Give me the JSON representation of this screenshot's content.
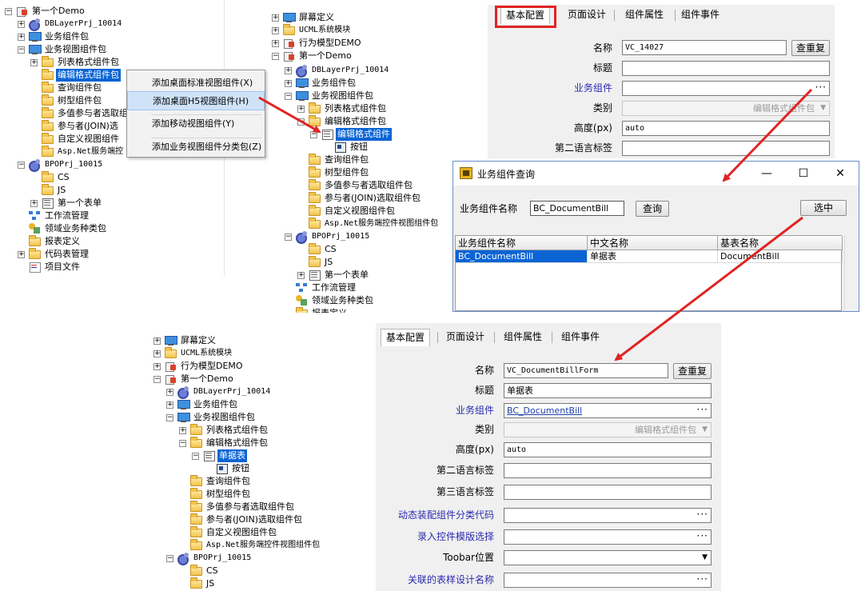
{
  "panel1": {
    "tree": [
      {
        "label": "第一个Demo",
        "icon": "proj-icon",
        "exp": "−"
      },
      {
        "label": "DBLayerPrj_10014",
        "icon": "gear-icon",
        "exp": "+",
        "mono": true
      },
      {
        "label": "业务组件包",
        "icon": "monitor-icon",
        "exp": "+"
      },
      {
        "label": "业务视图组件包",
        "icon": "monitor-icon",
        "exp": "−"
      },
      {
        "label": "列表格式组件包",
        "icon": "folder-icon",
        "exp": "+"
      },
      {
        "label": "编辑格式组件包",
        "icon": "folder-icon",
        "exp": "",
        "selected": true
      },
      {
        "label": "查询组件包",
        "icon": "folder-icon",
        "exp": ""
      },
      {
        "label": "树型组件包",
        "icon": "folder-icon",
        "exp": ""
      },
      {
        "label": "多值参与者选取组",
        "icon": "folder-icon",
        "exp": ""
      },
      {
        "label": "参与者(JOIN)选",
        "icon": "folder-icon",
        "exp": ""
      },
      {
        "label": "自定义视图组件",
        "icon": "folder-icon",
        "exp": ""
      },
      {
        "label": "Asp.Net服务端控",
        "icon": "folder-icon",
        "exp": "",
        "mono": true
      },
      {
        "label": "BPOPrj_10015",
        "icon": "gear-icon",
        "exp": "−",
        "mono": true
      },
      {
        "label": "CS",
        "icon": "folder-icon",
        "exp": ""
      },
      {
        "label": "JS",
        "icon": "folder-icon",
        "exp": ""
      },
      {
        "label": "第一个表单",
        "icon": "form-icon",
        "exp": "+"
      },
      {
        "label": "工作流管理",
        "icon": "flow-icon",
        "exp": ""
      },
      {
        "label": "领域业务种类包",
        "icon": "domain-icon",
        "exp": ""
      },
      {
        "label": "报表定义",
        "icon": "folder-icon",
        "exp": ""
      },
      {
        "label": "代码表管理",
        "icon": "folder-icon",
        "exp": "+"
      },
      {
        "label": "项目文件",
        "icon": "code-icon",
        "exp": ""
      }
    ],
    "context_menu": [
      "添加桌面标准视图组件(X)",
      "添加桌面H5视图组件(H)",
      "添加移动视图组件(Y)",
      "添加业务视图组件分类包(Z)"
    ]
  },
  "panel2": {
    "tree": [
      {
        "label": "屏幕定义",
        "icon": "monitor-icon",
        "exp": "+"
      },
      {
        "label": "UCML系统模块",
        "icon": "folder-icon",
        "exp": "+",
        "mono": true
      },
      {
        "label": "行为模型DEMO",
        "icon": "proj-icon",
        "exp": "+"
      },
      {
        "label": "第一个Demo",
        "icon": "proj-icon",
        "exp": "−"
      },
      {
        "label": "DBLayerPrj_10014",
        "icon": "gear-icon",
        "exp": "+",
        "mono": true
      },
      {
        "label": "业务组件包",
        "icon": "monitor-icon",
        "exp": "+"
      },
      {
        "label": "业务视图组件包",
        "icon": "monitor-icon",
        "exp": "−"
      },
      {
        "label": "列表格式组件包",
        "icon": "folder-icon",
        "exp": "+"
      },
      {
        "label": "编辑格式组件包",
        "icon": "folder-icon",
        "exp": "−"
      },
      {
        "label": "编辑格式组件",
        "icon": "form-icon",
        "exp": "−",
        "selected": true
      },
      {
        "label": "按钮",
        "icon": "button-icon",
        "exp": ""
      },
      {
        "label": "查询组件包",
        "icon": "folder-icon",
        "exp": ""
      },
      {
        "label": "树型组件包",
        "icon": "folder-icon",
        "exp": ""
      },
      {
        "label": "多值参与者选取组件包",
        "icon": "folder-icon",
        "exp": ""
      },
      {
        "label": "参与者(JOIN)选取组件包",
        "icon": "folder-icon",
        "exp": ""
      },
      {
        "label": "自定义视图组件包",
        "icon": "folder-icon",
        "exp": ""
      },
      {
        "label": "Asp.Net服务端控件视图组件包",
        "icon": "folder-icon",
        "exp": "",
        "mono": true
      },
      {
        "label": "BPOPrj_10015",
        "icon": "gear-icon",
        "exp": "−",
        "mono": true
      },
      {
        "label": "CS",
        "icon": "folder-icon",
        "exp": ""
      },
      {
        "label": "JS",
        "icon": "folder-icon",
        "exp": ""
      },
      {
        "label": "第一个表单",
        "icon": "form-icon",
        "exp": "+"
      },
      {
        "label": "工作流管理",
        "icon": "flow-icon",
        "exp": ""
      },
      {
        "label": "领域业务种类包",
        "icon": "domain-icon",
        "exp": ""
      },
      {
        "label": "报表定义",
        "icon": "folder-icon",
        "exp": ""
      }
    ]
  },
  "form1": {
    "tabs": [
      "基本配置",
      "页面设计",
      "组件属性",
      "组件事件"
    ],
    "fields": {
      "name_label": "名称",
      "name_value": "VC_14027",
      "reset_button": "查重复",
      "title_label": "标题",
      "title_value": "",
      "bc_label": "业务组件",
      "bc_value": "",
      "category_label": "类别",
      "category_value": "编辑格式组件包",
      "height_label": "高度(px)",
      "height_value": "auto",
      "lang2_label": "第二语言标签",
      "lang2_value": ""
    }
  },
  "dialog": {
    "title": "业务组件查询",
    "search_label": "业务组件名称",
    "search_value": "BC_DocumentBill",
    "query_button": "查询",
    "select_button": "选中",
    "columns": [
      "业务组件名称",
      "中文名称",
      "基表名称"
    ],
    "rows": [
      [
        "BC_DocumentBill",
        "单据表",
        "DocumentBill"
      ]
    ],
    "controls": {
      "minimize": "—",
      "maximize": "☐",
      "close": "✕"
    }
  },
  "panel3": {
    "tree": [
      {
        "label": "屏幕定义",
        "icon": "monitor-icon",
        "exp": "+"
      },
      {
        "label": "UCML系统模块",
        "icon": "folder-icon",
        "exp": "+",
        "mono": true
      },
      {
        "label": "行为模型DEMO",
        "icon": "proj-icon",
        "exp": "+"
      },
      {
        "label": "第一个Demo",
        "icon": "proj-icon",
        "exp": "−"
      },
      {
        "label": "DBLayerPrj_10014",
        "icon": "gear-icon",
        "exp": "+",
        "mono": true
      },
      {
        "label": "业务组件包",
        "icon": "monitor-icon",
        "exp": "+"
      },
      {
        "label": "业务视图组件包",
        "icon": "monitor-icon",
        "exp": "−"
      },
      {
        "label": "列表格式组件包",
        "icon": "folder-icon",
        "exp": "+"
      },
      {
        "label": "编辑格式组件包",
        "icon": "folder-icon",
        "exp": "−"
      },
      {
        "label": "单据表",
        "icon": "form-icon",
        "exp": "−",
        "selected": true
      },
      {
        "label": "按钮",
        "icon": "button-icon",
        "exp": ""
      },
      {
        "label": "查询组件包",
        "icon": "folder-icon",
        "exp": ""
      },
      {
        "label": "树型组件包",
        "icon": "folder-icon",
        "exp": ""
      },
      {
        "label": "多值参与者选取组件包",
        "icon": "folder-icon",
        "exp": ""
      },
      {
        "label": "参与者(JOIN)选取组件包",
        "icon": "folder-icon",
        "exp": ""
      },
      {
        "label": "自定义视图组件包",
        "icon": "folder-icon",
        "exp": ""
      },
      {
        "label": "Asp.Net服务端控件视图组件包",
        "icon": "folder-icon",
        "exp": "",
        "mono": true
      },
      {
        "label": "BPOPrj_10015",
        "icon": "gear-icon",
        "exp": "−",
        "mono": true
      },
      {
        "label": "CS",
        "icon": "folder-icon",
        "exp": ""
      },
      {
        "label": "JS",
        "icon": "folder-icon",
        "exp": ""
      }
    ]
  },
  "form2": {
    "tabs": [
      "基本配置",
      "页面设计",
      "组件属性",
      "组件事件"
    ],
    "fields": {
      "name_label": "名称",
      "name_value": "VC_DocumentBillForm",
      "reset_button": "查重复",
      "title_label": "标题",
      "title_value": "单据表",
      "bc_label": "业务组件",
      "bc_value": "BC_DocumentBill",
      "category_label": "类别",
      "category_value": "编辑格式组件包",
      "height_label": "高度(px)",
      "height_value": "auto",
      "lang2_label": "第二语言标签",
      "lang2_value": "",
      "lang3_label": "第三语言标签",
      "lang3_value": "",
      "dyn_label": "动态装配组件分类代码",
      "dyn_value": "",
      "tmpl_label": "录入控件模版选择",
      "tmpl_value": "",
      "toolbar_label": "Toobar位置",
      "toolbar_value": "",
      "sample_label": "关联的表样设计名称",
      "sample_value": ""
    }
  },
  "colors": {
    "accent_red": "#e02424",
    "selection_blue": "#0a64d4",
    "link_blue": "#2a2ab0"
  }
}
